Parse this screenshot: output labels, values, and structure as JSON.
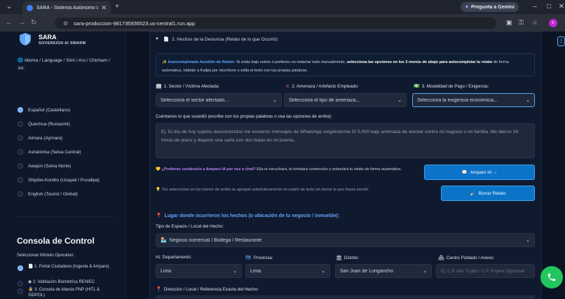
{
  "browser": {
    "tab_title": "SARA - Sistema Autónomo de",
    "gemini_button": "Pregunta a Gemini",
    "url": "sara-produccion-981735936523.us-central1.run.app",
    "avatar_letter": "c"
  },
  "sidebar": {
    "brand": "SARA",
    "brand_sub": "SOVEREIGN AI SWARM",
    "language_label": "Idioma / Language / Simi / Aru / Chicham / Joi:",
    "languages": [
      {
        "label": "Español (Castellano)",
        "selected": true
      },
      {
        "label": "Quechua (Runasimi)",
        "selected": false
      },
      {
        "label": "Aimara (Aymara)",
        "selected": false
      },
      {
        "label": "Asháninka (Selva Central)",
        "selected": false
      },
      {
        "label": "Awajún (Selva Norte)",
        "selected": false
      },
      {
        "label": "Shipibo-Konibo (Ucayali / Pucallpa)",
        "selected": false
      },
      {
        "label": "English (Tourist / Global)",
        "selected": false
      }
    ],
    "console_title": "Consola de Control",
    "module_label": "Seleccionar Módulo Operativo:",
    "modules": [
      {
        "label": "1. Portal Ciudadano (Ingesta & Amparo)",
        "selected": true
      },
      {
        "label": "2. Validación Biométrica RENIEC",
        "selected": false
      },
      {
        "label": "3. Consola de Mando PNP (HITL & SIDPOL)",
        "selected": false
      }
    ]
  },
  "main": {
    "expander_title": "2. Hechos de la Denuncia (Relato de lo que Ocurrió)",
    "banner": {
      "highlight": "Autocompletado Asistido de Relato:",
      "text1": "Si estás bajo estrés o prefieres no redactar todo manualmente,",
      "bold": "selecciona las opciones en los 3 menús de abajo para autocompletar tu relato",
      "text2": "de forma automática, háblale a Kallpa por micrófono o edita el texto con tus propias palabras."
    },
    "sector_label": "1. Sector / Víctima Afectada:",
    "sector_value": "Selecciona el sector afectado...",
    "amenaza_label": "2. Amenaza / Artefacto Empleado:",
    "amenaza_value": "Selecciona el tipo de amenaza...",
    "pago_label": "3. Modalidad de Pago / Exigencia:",
    "pago_value": "Selecciona la exigencia económica...",
    "relato_label": "Cuéntanos lo que sucedió (escribe con tus propias palabras o usa las opciones de arriba):",
    "relato_placeholder": "Ej. El día de hoy sujetos desconocidos me enviaron mensajes de WhatsApp exigiéndome S/ 5,000 bajo amenaza de atentar contra mi negocio o mi familia. Me dieron 24 horas de plazo y dejaron una carta con dos balas en mi puerta...",
    "amparo_prompt": "¿Prefieres contárselo a Amparo IA por voz o chat?",
    "amparo_text": "Ella te escuchará, te brindará contención y redactará tu relato de forma automática.",
    "tip_text": "Tus selecciones en los menús de arriba se agregan automáticamente al cuadro de texto sin borrar lo que hayas escrito.",
    "amparo_button": "Amparo IA →",
    "borrar_button": "Borrar Relato",
    "lugar_title": "Lugar donde ocurrieron los hechos (o ubicación de tu negocio / inmueble):",
    "espacio_label": "Tipo de Espacio / Local del Hecho:",
    "espacio_value": "Negocio comercial / Bodega / Restaurante",
    "departamento_label": "Departamento:",
    "departamento_prefix": "PE",
    "departamento_value": "Lima",
    "provincia_label": "Provincia:",
    "provincia_value": "Lima",
    "distrito_label": "Distrito:",
    "distrito_value": "San Juan de Lurigancho",
    "centro_label": "Centro Poblado / Anexo:",
    "centro_placeholder": "Ej. C.P. Alto Trujillo / C.P. Poyeni (Opcional",
    "direccion_label": "Dirección / Local / Referencia Exacta del Hecho:"
  },
  "colors": {
    "accent": "#60a5fa",
    "button": "#0b74c8",
    "fab": "#22c55e"
  }
}
